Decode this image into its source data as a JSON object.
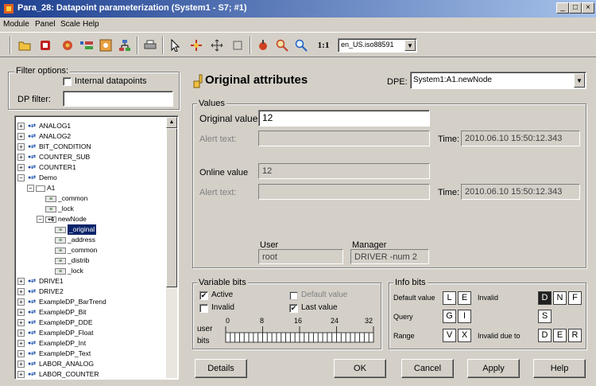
{
  "window": {
    "title": "Para_28: Datapoint parameterization (System1 - S7; #1)",
    "btn_min": "_",
    "btn_max": "□",
    "btn_close": "×"
  },
  "menu": [
    "Module",
    "Panel",
    "Scale",
    "Help"
  ],
  "toolbar": {
    "zoom_label": "1:1",
    "lang_value": "en_US.iso88591"
  },
  "filter": {
    "group_label": "Filter options:",
    "internal_label": "Internal datapoints",
    "dp_filter_label": "DP filter:",
    "dp_filter_value": ""
  },
  "tree": {
    "items": [
      {
        "label": "ANALOG1",
        "level": 0,
        "pm": "+"
      },
      {
        "label": "ANALOG2",
        "level": 0,
        "pm": "+"
      },
      {
        "label": "BIT_CONDITION",
        "level": 0,
        "pm": "+"
      },
      {
        "label": "COUNTER_SUB",
        "level": 0,
        "pm": "+"
      },
      {
        "label": "COUNTER1",
        "level": 0,
        "pm": "+"
      },
      {
        "label": "Demo",
        "level": 0,
        "pm": "−"
      },
      {
        "label": "A1",
        "level": 1,
        "pm": "−"
      },
      {
        "label": "_common",
        "level": 2,
        "pm": ""
      },
      {
        "label": "_lock",
        "level": 2,
        "pm": ""
      },
      {
        "label": "newNode",
        "level": 2,
        "pm": "−"
      },
      {
        "label": "_original",
        "level": 3,
        "pm": "",
        "selected": true
      },
      {
        "label": "_address",
        "level": 3,
        "pm": ""
      },
      {
        "label": "_common",
        "level": 3,
        "pm": ""
      },
      {
        "label": "_distrib",
        "level": 3,
        "pm": ""
      },
      {
        "label": "_lock",
        "level": 3,
        "pm": ""
      },
      {
        "label": "DRIVE1",
        "level": 0,
        "pm": "+"
      },
      {
        "label": "DRIVE2",
        "level": 0,
        "pm": "+"
      },
      {
        "label": "ExampleDP_BarTrend",
        "level": 0,
        "pm": "+"
      },
      {
        "label": "ExampleDP_Bit",
        "level": 0,
        "pm": "+"
      },
      {
        "label": "ExampleDP_DDE",
        "level": 0,
        "pm": "+"
      },
      {
        "label": "ExampleDP_Float",
        "level": 0,
        "pm": "+"
      },
      {
        "label": "ExampleDP_Int",
        "level": 0,
        "pm": "+"
      },
      {
        "label": "ExampleDP_Text",
        "level": 0,
        "pm": "+"
      },
      {
        "label": "LABOR_ANALOG",
        "level": 0,
        "pm": "+"
      },
      {
        "label": "LABOR_COUNTER",
        "level": 0,
        "pm": "+"
      }
    ]
  },
  "main": {
    "heading": "Original attributes",
    "dpe_label": "DPE:",
    "dpe_value": "System1:A1.newNode",
    "values_group": "Values",
    "original_value_label": "Original value:",
    "original_value": "12",
    "alert_text_label": "Alert text:",
    "alert_text_value": "",
    "time_label": "Time:",
    "time_value": "2010.06.10 15:50:12.343",
    "online_value_label": "Online value",
    "online_value": "12",
    "alert_text2_label": "Alert text:",
    "time2_label": "Time:",
    "time2_value": "2010.06.10 15:50:12.343",
    "user_label": "User",
    "user_value": "root",
    "manager_label": "Manager",
    "manager_value": "DRIVER -num 2"
  },
  "variable_bits": {
    "group_label": "Variable bits",
    "active_label": "Active",
    "invalid_label": "Invalid",
    "default_value_label": "Default value",
    "last_value_label": "Last value",
    "active_checked": true,
    "invalid_checked": false,
    "default_checked": false,
    "last_checked": true,
    "user_label": "user",
    "bits_label": "bits",
    "ruler_ticks": [
      "0",
      "8",
      "16",
      "24",
      "32"
    ]
  },
  "info_bits": {
    "group_label": "Info bits",
    "default_value_label": "Default value",
    "invalid_label": "Invalid",
    "query_label": "Query",
    "range_label": "Range",
    "invalid_due_label": "Invalid due to",
    "row1_left": [
      "L",
      "E"
    ],
    "row1_right": [
      "D",
      "N",
      "F"
    ],
    "row2_left": [
      "G",
      "I"
    ],
    "row2_right": [
      "S"
    ],
    "row3_left": [
      "V",
      "X"
    ],
    "row3_right": [
      "D",
      "E",
      "R"
    ]
  },
  "buttons": {
    "details": "Details",
    "ok": "OK",
    "cancel": "Cancel",
    "apply": "Apply",
    "help": "Help"
  }
}
